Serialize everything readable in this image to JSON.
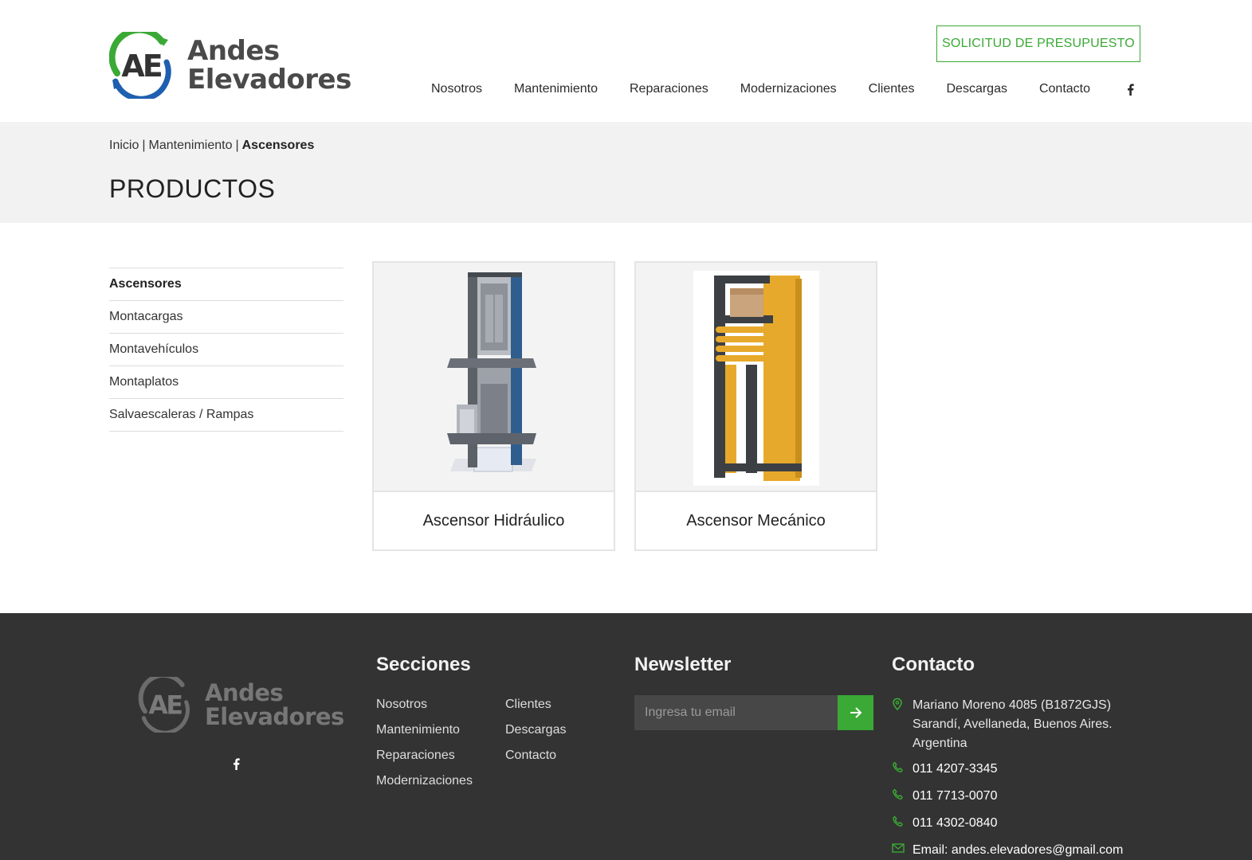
{
  "top_progress": {
    "fraction": 0.2
  },
  "header": {
    "logo_line1": "Andes",
    "logo_line2": "Elevadores",
    "cta_label": "SOLICITUD DE PRESUPUESTO",
    "nav": [
      "Nosotros",
      "Mantenimiento",
      "Reparaciones",
      "Modernizaciones",
      "Clientes",
      "Descargas",
      "Contacto"
    ],
    "social_icon": "facebook-icon"
  },
  "breadcrumb": {
    "home": "Inicio",
    "separator": "|",
    "section": "Mantenimiento",
    "current": "Ascensores"
  },
  "page_title": "PRODUCTOS",
  "sidebar": {
    "items": [
      "Ascensores",
      "Montacargas",
      "Montavehículos",
      "Montaplatos",
      "Salvaescaleras / Rampas"
    ],
    "active_index": 0
  },
  "products": [
    {
      "name": "Ascensor Hidráulico"
    },
    {
      "name": "Ascensor Mecánico"
    }
  ],
  "footer": {
    "logo_line1": "Andes",
    "logo_line2": "Elevadores",
    "sections_title": "Secciones",
    "sections_col1": [
      "Nosotros",
      "Mantenimiento",
      "Reparaciones",
      "Modernizaciones"
    ],
    "sections_col2": [
      "Clientes",
      "Descargas",
      "Contacto"
    ],
    "newsletter_title": "Newsletter",
    "newsletter_placeholder": "Ingresa tu email",
    "contact_title": "Contacto",
    "address_line1": "Mariano Moreno 4085 (B1872GJS)",
    "address_line2": "Sarandí, Avellaneda, Buenos Aires.",
    "address_line3": "Argentina",
    "phones": [
      "011 4207-3345",
      "011 7713-0070",
      "011 4302-0840"
    ],
    "email": "Email: andes.elevadores@gmail.com"
  },
  "colors": {
    "brand_green": "#3aa935",
    "brand_blue": "#1f5fb0",
    "footer_bg": "#333333",
    "titlebar_bg": "#f2f2f2"
  }
}
